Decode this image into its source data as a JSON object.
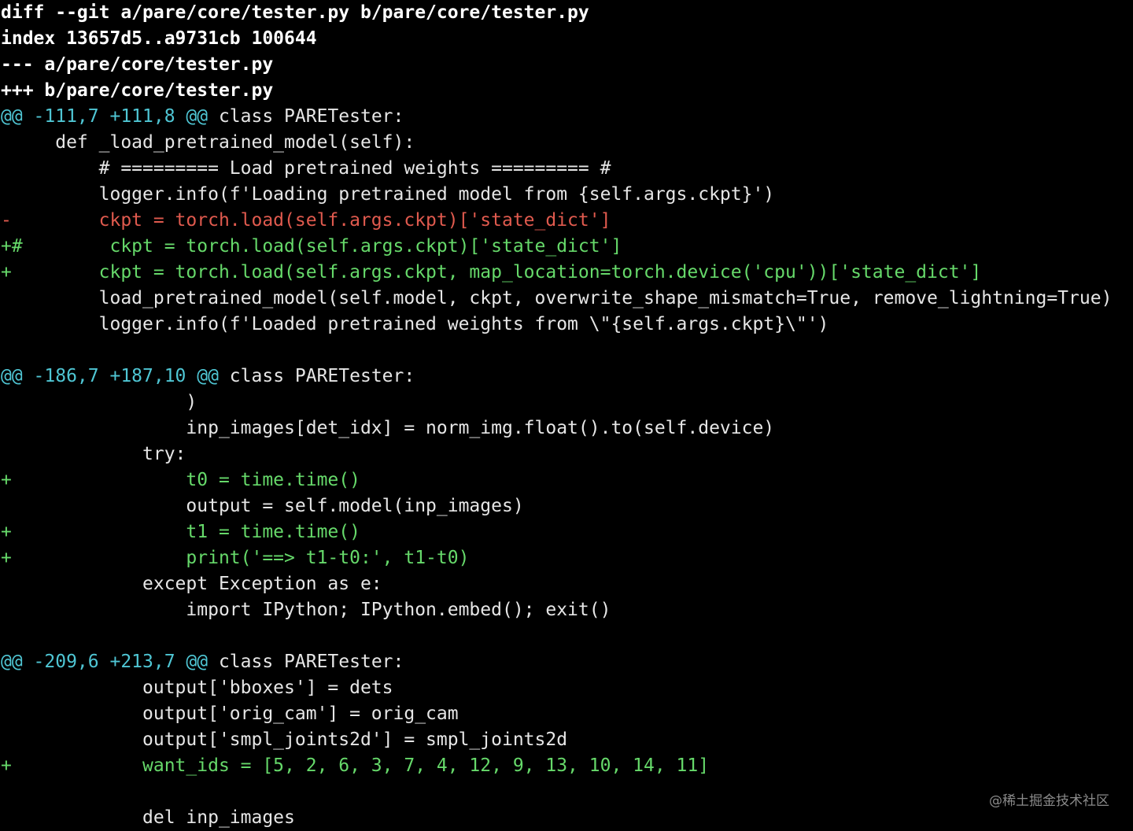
{
  "terminal": {
    "colors": {
      "background": "#000000",
      "context": "#e6e6e6",
      "deleted": "#e05a4e",
      "added": "#66d96a",
      "hunk_header": "#4fc6d4"
    },
    "lines": [
      {
        "type": "meta",
        "text": "diff --git a/pare/core/tester.py b/pare/core/tester.py"
      },
      {
        "type": "meta",
        "text": "index 13657d5..a9731cb 100644"
      },
      {
        "type": "meta",
        "text": "--- a/pare/core/tester.py"
      },
      {
        "type": "meta",
        "text": "+++ b/pare/core/tester.py"
      },
      {
        "type": "hunk",
        "range": "@@ -111,7 +111,8 @@",
        "context": " class PARETester:"
      },
      {
        "type": "ctx",
        "text": "     def _load_pretrained_model(self):"
      },
      {
        "type": "ctx",
        "text": "         # ========= Load pretrained weights ========= #"
      },
      {
        "type": "ctx",
        "text": "         logger.info(f'Loading pretrained model from {self.args.ckpt}')"
      },
      {
        "type": "del",
        "text": "-        ckpt = torch.load(self.args.ckpt)['state_dict']"
      },
      {
        "type": "add",
        "text": "+#        ckpt = torch.load(self.args.ckpt)['state_dict']"
      },
      {
        "type": "add",
        "text": "+        ckpt = torch.load(self.args.ckpt, map_location=torch.device('cpu'))['state_dict']"
      },
      {
        "type": "ctx",
        "text": "         load_pretrained_model(self.model, ckpt, overwrite_shape_mismatch=True, remove_lightning=True)"
      },
      {
        "type": "ctx",
        "text": "         logger.info(f'Loaded pretrained weights from \\\"{self.args.ckpt}\\\"')"
      },
      {
        "type": "ctx",
        "text": ""
      },
      {
        "type": "hunk",
        "range": "@@ -186,7 +187,10 @@",
        "context": " class PARETester:"
      },
      {
        "type": "ctx",
        "text": "                 )"
      },
      {
        "type": "ctx",
        "text": "                 inp_images[det_idx] = norm_img.float().to(self.device)"
      },
      {
        "type": "ctx",
        "text": "             try:"
      },
      {
        "type": "add",
        "text": "+                t0 = time.time()"
      },
      {
        "type": "ctx",
        "text": "                 output = self.model(inp_images)"
      },
      {
        "type": "add",
        "text": "+                t1 = time.time()"
      },
      {
        "type": "add",
        "text": "+                print('==> t1-t0:', t1-t0)"
      },
      {
        "type": "ctx",
        "text": "             except Exception as e:"
      },
      {
        "type": "ctx",
        "text": "                 import IPython; IPython.embed(); exit()"
      },
      {
        "type": "ctx",
        "text": ""
      },
      {
        "type": "hunk",
        "range": "@@ -209,6 +213,7 @@",
        "context": " class PARETester:"
      },
      {
        "type": "ctx",
        "text": "             output['bboxes'] = dets"
      },
      {
        "type": "ctx",
        "text": "             output['orig_cam'] = orig_cam"
      },
      {
        "type": "ctx",
        "text": "             output['smpl_joints2d'] = smpl_joints2d"
      },
      {
        "type": "add",
        "text": "+            want_ids = [5, 2, 6, 3, 7, 4, 12, 9, 13, 10, 14, 11]"
      },
      {
        "type": "ctx",
        "text": ""
      },
      {
        "type": "ctx",
        "text": "             del inp_images"
      }
    ]
  },
  "watermark": "@稀土掘金技术社区"
}
